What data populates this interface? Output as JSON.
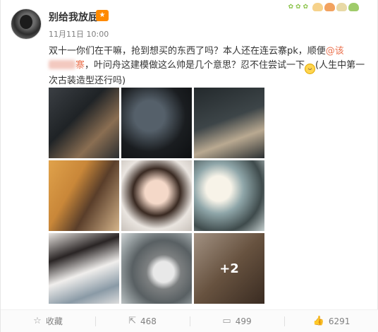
{
  "post": {
    "username": "别给我放屁",
    "timestamp": "11月11日 10:00",
    "text_part1": "双十一你们在干嘛，抢到想买的东西了吗？本人还在连云寨pk，顺便",
    "mention": "@该",
    "mention_tail": "寨",
    "text_part2": "，叶问舟这建模做这么帅是几个意思？忍不住尝试一下",
    "text_part3": "(人生中第一次古装造型还行吗)",
    "more_count": "+2"
  },
  "images": [
    "photo-1",
    "photo-2",
    "photo-3",
    "photo-4",
    "photo-5",
    "photo-6",
    "photo-7",
    "photo-8",
    "photo-9"
  ],
  "actions": {
    "favorite_label": "收藏",
    "repost_count": "468",
    "comment_count": "499",
    "like_count": "6291"
  },
  "icons": {
    "favorite": "star-icon",
    "repost": "repost-icon",
    "comment": "comment-icon",
    "like": "thumbs-up-icon"
  },
  "colors": {
    "mention": "#eb7350",
    "vip_badge": "#ff8a00",
    "meta_text": "#808080"
  }
}
